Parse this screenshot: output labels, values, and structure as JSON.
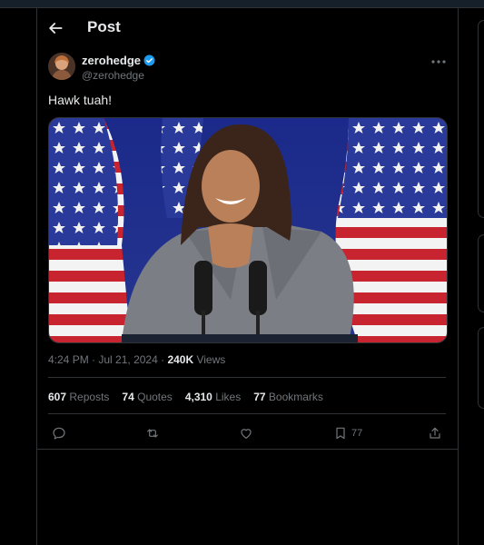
{
  "header": {
    "title": "Post"
  },
  "author": {
    "name": "zerohedge",
    "handle": "@zerohedge",
    "verified": true
  },
  "post": {
    "text": "Hawk tuah!"
  },
  "meta": {
    "time": "4:24 PM",
    "separator": " · ",
    "date": "Jul 21, 2024",
    "views_count": "240K",
    "views_label": " Views"
  },
  "stats": {
    "reposts_count": "607",
    "reposts_label": "Reposts",
    "quotes_count": "74",
    "quotes_label": "Quotes",
    "likes_count": "4,310",
    "likes_label": "Likes",
    "bookmarks_count": "77",
    "bookmarks_label": "Bookmarks"
  },
  "actions": {
    "bookmark_count": "77"
  },
  "icons": [
    "back-arrow-icon",
    "verified-badge-icon",
    "more-icon",
    "reply-icon",
    "repost-icon",
    "like-icon",
    "bookmark-icon",
    "share-icon"
  ],
  "colors": {
    "background": "#000000",
    "text": "#e7e9ea",
    "muted": "#71767b",
    "border": "#2f3336",
    "verified": "#1d9bf0"
  }
}
